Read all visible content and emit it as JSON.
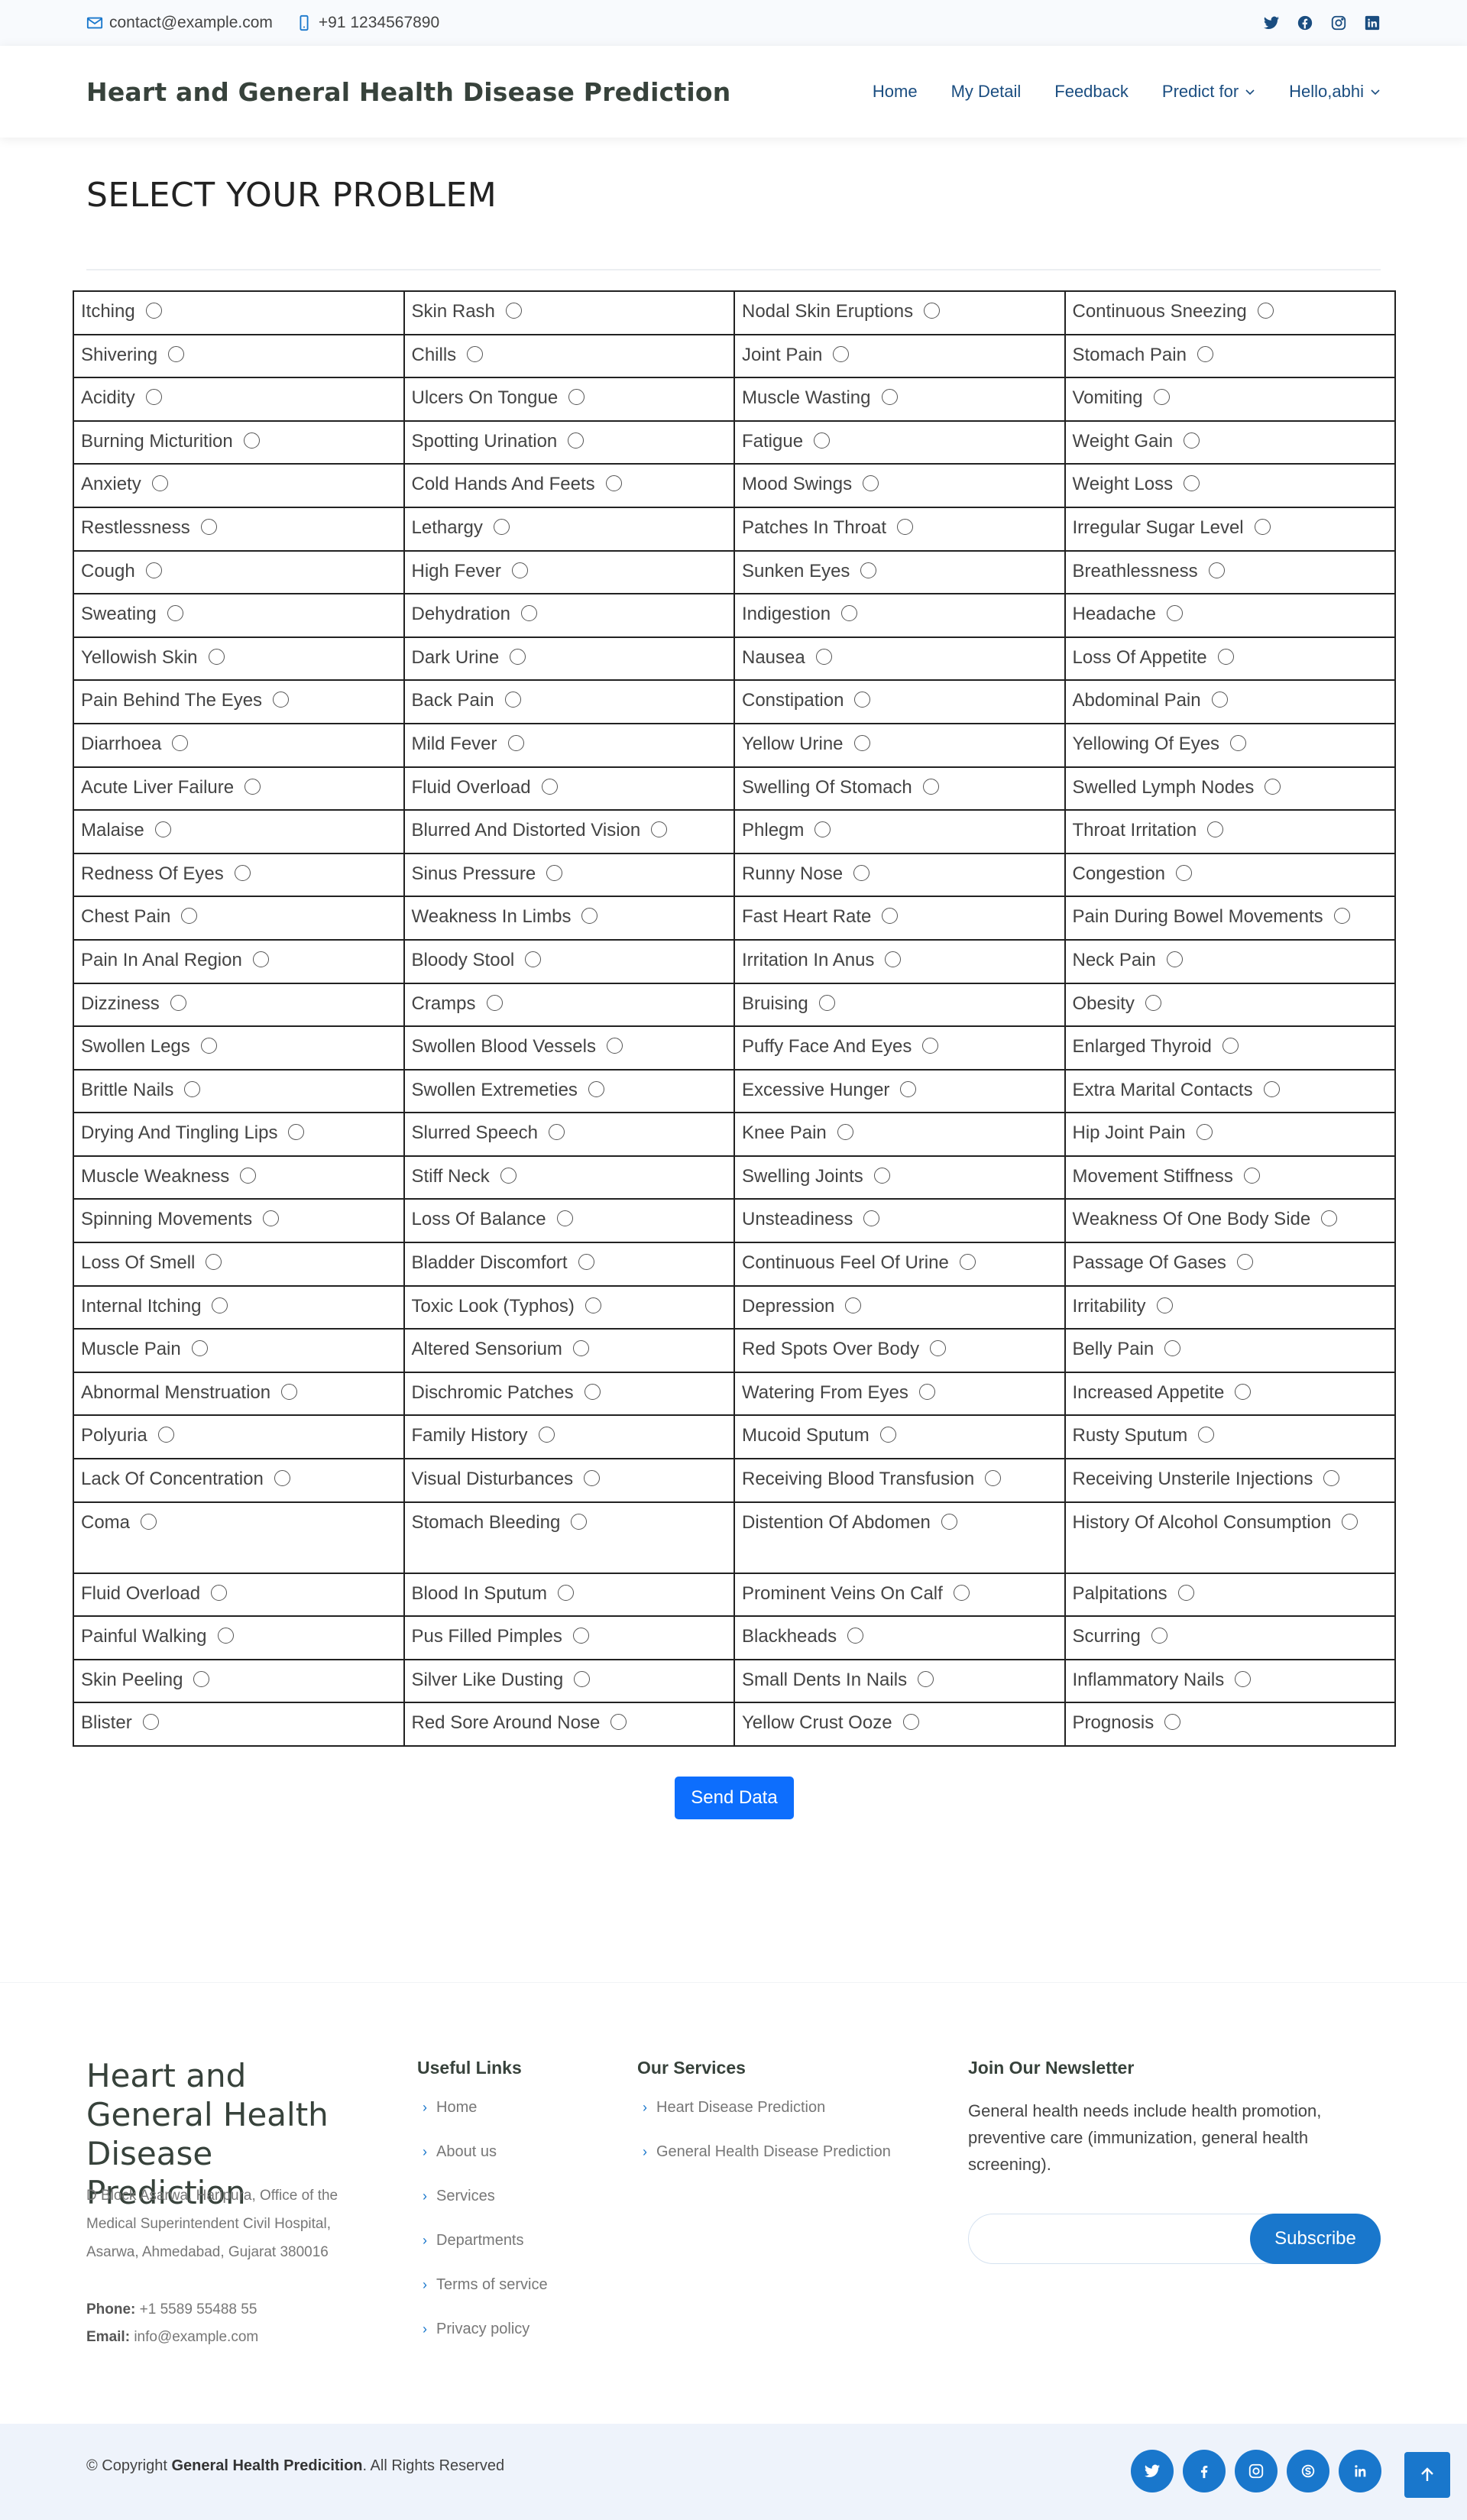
{
  "topbar": {
    "email": "contact@example.com",
    "phone": "+91 1234567890",
    "socials": [
      "twitter-icon",
      "facebook-icon",
      "instagram-icon",
      "linkedin-icon"
    ]
  },
  "header": {
    "brand": "Heart and General Health Disease Prediction",
    "nav": [
      {
        "label": "Home",
        "dropdown": false
      },
      {
        "label": "My Detail",
        "dropdown": false
      },
      {
        "label": "Feedback",
        "dropdown": false
      },
      {
        "label": "Predict for",
        "dropdown": true
      },
      {
        "label": "Hello,abhi",
        "dropdown": true
      }
    ]
  },
  "main": {
    "title": "SELECT YOUR PROBLEM",
    "symptoms": [
      [
        "Itching",
        "Skin Rash",
        "Nodal Skin Eruptions",
        "Continuous Sneezing"
      ],
      [
        "Shivering",
        "Chills",
        "Joint Pain",
        "Stomach Pain"
      ],
      [
        "Acidity",
        "Ulcers On Tongue",
        "Muscle Wasting",
        "Vomiting"
      ],
      [
        "Burning Micturition",
        "Spotting Urination",
        "Fatigue",
        "Weight Gain"
      ],
      [
        "Anxiety",
        "Cold Hands And Feets",
        "Mood Swings",
        "Weight Loss"
      ],
      [
        "Restlessness",
        "Lethargy",
        "Patches In Throat",
        "Irregular Sugar Level"
      ],
      [
        "Cough",
        "High Fever",
        "Sunken Eyes",
        "Breathlessness"
      ],
      [
        "Sweating",
        "Dehydration",
        "Indigestion",
        "Headache"
      ],
      [
        "Yellowish Skin",
        "Dark Urine",
        "Nausea",
        "Loss Of Appetite"
      ],
      [
        "Pain Behind The Eyes",
        "Back Pain",
        "Constipation",
        "Abdominal Pain"
      ],
      [
        "Diarrhoea",
        "Mild Fever",
        "Yellow Urine",
        "Yellowing Of Eyes"
      ],
      [
        "Acute Liver Failure",
        "Fluid Overload",
        "Swelling Of Stomach",
        "Swelled Lymph Nodes"
      ],
      [
        "Malaise",
        "Blurred And Distorted Vision",
        "Phlegm",
        "Throat Irritation"
      ],
      [
        "Redness Of Eyes",
        "Sinus Pressure",
        "Runny Nose",
        "Congestion"
      ],
      [
        "Chest Pain",
        "Weakness In Limbs",
        "Fast Heart Rate",
        "Pain During Bowel Movements"
      ],
      [
        "Pain In Anal Region",
        "Bloody Stool",
        "Irritation In Anus",
        "Neck Pain"
      ],
      [
        "Dizziness",
        "Cramps",
        "Bruising",
        "Obesity"
      ],
      [
        "Swollen Legs",
        "Swollen Blood Vessels",
        "Puffy Face And Eyes",
        "Enlarged Thyroid"
      ],
      [
        "Brittle Nails",
        "Swollen Extremeties",
        "Excessive Hunger",
        "Extra Marital Contacts"
      ],
      [
        "Drying And Tingling Lips",
        "Slurred Speech",
        "Knee Pain",
        "Hip Joint Pain"
      ],
      [
        "Muscle Weakness",
        "Stiff Neck",
        "Swelling Joints",
        "Movement Stiffness"
      ],
      [
        "Spinning Movements",
        "Loss Of Balance",
        "Unsteadiness",
        "Weakness Of One Body Side"
      ],
      [
        "Loss Of Smell",
        "Bladder Discomfort",
        "Continuous Feel Of Urine",
        "Passage Of Gases"
      ],
      [
        "Internal Itching",
        "Toxic Look (Typhos)",
        "Depression",
        "Irritability"
      ],
      [
        "Muscle Pain",
        "Altered Sensorium",
        "Red Spots Over Body",
        "Belly Pain"
      ],
      [
        "Abnormal Menstruation",
        "Dischromic Patches",
        "Watering From Eyes",
        "Increased Appetite"
      ],
      [
        "Polyuria",
        "Family History",
        "Mucoid Sputum",
        "Rusty Sputum"
      ],
      [
        "Lack Of Concentration",
        "Visual Disturbances",
        "Receiving Blood Transfusion",
        "Receiving Unsterile Injections"
      ],
      [
        "Coma",
        "Stomach Bleeding",
        "Distention Of Abdomen",
        "History Of Alcohol Consumption"
      ],
      [
        "Fluid Overload",
        "Blood In Sputum",
        "Prominent Veins On Calf",
        "Palpitations"
      ],
      [
        "Painful Walking",
        "Pus Filled Pimples",
        "Blackheads",
        "Scurring"
      ],
      [
        "Skin Peeling",
        "Silver Like Dusting",
        "Small Dents In Nails",
        "Inflammatory Nails"
      ],
      [
        "Blister",
        "Red Sore Around Nose",
        "Yellow Crust Ooze",
        "Prognosis"
      ]
    ],
    "send_label": "Send Data"
  },
  "footer": {
    "brand": "Heart and General Health Disease Prediction",
    "address": "D Block Asarwa, Haripura, Office of the Medical Superintendent Civil Hospital, Asarwa, Ahmedabad, Gujarat 380016",
    "phone_label": "Phone:",
    "phone": "+1 5589 55488 55",
    "email_label": "Email:",
    "email": "info@example.com",
    "useful_title": "Useful Links",
    "useful_links": [
      "Home",
      "About us",
      "Services",
      "Departments",
      "Terms of service",
      "Privacy policy"
    ],
    "services_title": "Our Services",
    "services": [
      "Heart Disease Prediction",
      "General Health Disease Prediction"
    ],
    "newsletter_title": "Join Our Newsletter",
    "newsletter_text": "General health needs include health promotion, preventive care (immunization, general health screening).",
    "newsletter_placeholder": "",
    "subscribe_label": "Subscribe",
    "copyright_prefix": "© Copyright ",
    "copyright_brand": "General Health Predicition",
    "copyright_suffix": ". All Rights Reserved",
    "socials": [
      "twitter-icon",
      "facebook-icon",
      "instagram-icon",
      "skype-icon",
      "linkedin-icon"
    ]
  },
  "colors": {
    "accent": "#1977cc",
    "button": "#0d6efd",
    "nav": "#1a4d80"
  }
}
